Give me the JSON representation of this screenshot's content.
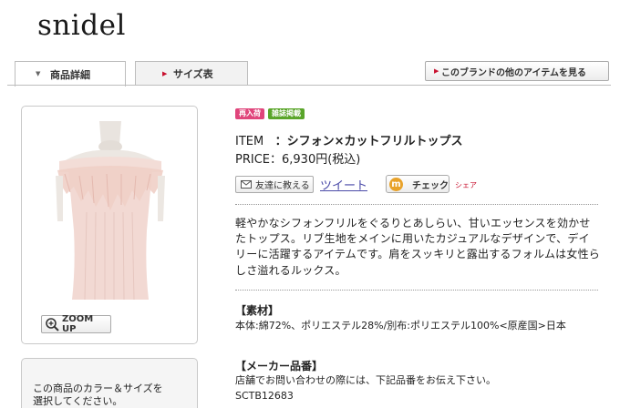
{
  "brand": {
    "logo": "snidel"
  },
  "tabs": [
    {
      "label": "商品詳細",
      "active": true
    },
    {
      "label": "サイズ表",
      "active": false
    }
  ],
  "brand_items_button": "このブランドの他のアイテムを見る",
  "photo": {
    "zoom_label": "ZOOM UP",
    "icon": "magnifier-icon"
  },
  "color_size_prompt": {
    "line1": "この商品のカラー＆サイズを",
    "line2": "選択してください。"
  },
  "badges": [
    {
      "label": "再入荷",
      "color": "#e0457b"
    },
    {
      "label": "雑誌掲載",
      "color": "#5aa52a"
    }
  ],
  "item": {
    "item_label": "ITEM",
    "name": "：シフォン×カットフリルトップス",
    "price_label": "PRICE",
    "price": "：6,930円(税込)"
  },
  "social": {
    "tell_friend": "友達に教える",
    "tweet": "ツイート",
    "check": "チェック",
    "share": "シェア"
  },
  "description": "軽やかなシフォンフリルをぐるりとあしらい、甘いエッセンスを効かせたトップス。リブ生地をメインに用いたカジュアルなデザインで、デイリーに活躍するアイテムです。肩をスッキリと露出するフォルムは女性らしさ溢れるルックス。",
  "material": {
    "heading": "【素材】",
    "body": "本体:綿72%、ポリエステル28%/別布:ポリエステル100%<原産国>日本"
  },
  "maker_code": {
    "heading": "【メーカー品番】",
    "body": "店舗でお問い合わせの際には、下記品番をお伝え下さい。",
    "code": "SCTB12683"
  },
  "colors": {
    "accent_red": "#c8102e",
    "link_blue": "#4a4aa8",
    "check_orange": "#e8a22a"
  }
}
